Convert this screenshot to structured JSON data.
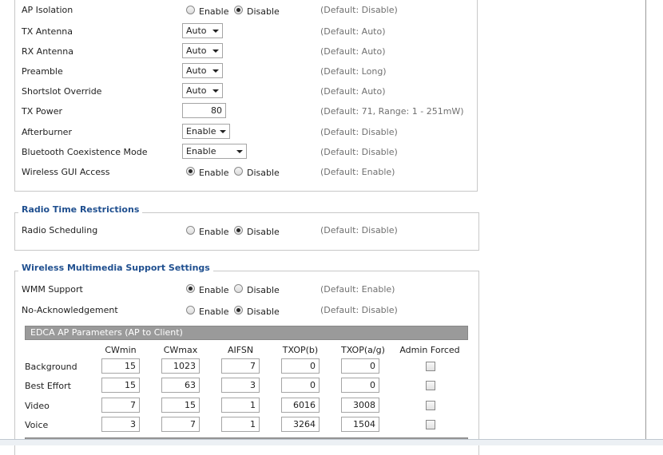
{
  "general": {
    "ap_isolation": {
      "label": "AP Isolation",
      "enable": "Enable",
      "disable": "Disable",
      "hint": "(Default: Disable)"
    },
    "tx_antenna": {
      "label": "TX Antenna",
      "value": "Auto",
      "hint": "(Default: Auto)"
    },
    "rx_antenna": {
      "label": "RX Antenna",
      "value": "Auto",
      "hint": "(Default: Auto)"
    },
    "preamble": {
      "label": "Preamble",
      "value": "Auto",
      "hint": "(Default: Long)"
    },
    "shortslot": {
      "label": "Shortslot Override",
      "value": "Auto",
      "hint": "(Default: Auto)"
    },
    "tx_power": {
      "label": "TX Power",
      "value": "80",
      "hint": "(Default: 71, Range: 1 - 251mW)"
    },
    "afterburner": {
      "label": "Afterburner",
      "value": "Enable",
      "hint": "(Default: Disable)"
    },
    "bluetooth": {
      "label": "Bluetooth Coexistence Mode",
      "value": "Enable",
      "hint": "(Default: Disable)"
    },
    "gui_access": {
      "label": "Wireless GUI Access",
      "enable": "Enable",
      "disable": "Disable",
      "hint": "(Default: Enable)"
    }
  },
  "radio_time": {
    "legend": "Radio Time Restrictions",
    "scheduling": {
      "label": "Radio Scheduling",
      "enable": "Enable",
      "disable": "Disable",
      "hint": "(Default: Disable)"
    }
  },
  "wmm": {
    "legend": "Wireless Multimedia Support Settings",
    "support": {
      "label": "WMM Support",
      "enable": "Enable",
      "disable": "Disable",
      "hint": "(Default: Enable)"
    },
    "noack": {
      "label": "No-Acknowledgement",
      "enable": "Enable",
      "disable": "Disable",
      "hint": "(Default: Disable)"
    },
    "edca_title": "EDCA AP Parameters (AP to Client)",
    "columns": [
      "CWmin",
      "CWmax",
      "AIFSN",
      "TXOP(b)",
      "TXOP(a/g)",
      "Admin Forced"
    ],
    "rows": [
      {
        "name": "Background",
        "values": [
          "15",
          "1023",
          "7",
          "0",
          "0"
        ]
      },
      {
        "name": "Best Effort",
        "values": [
          "15",
          "63",
          "3",
          "0",
          "0"
        ]
      },
      {
        "name": "Video",
        "values": [
          "7",
          "15",
          "1",
          "6016",
          "3008"
        ]
      },
      {
        "name": "Voice",
        "values": [
          "3",
          "7",
          "1",
          "3264",
          "1504"
        ]
      }
    ]
  }
}
